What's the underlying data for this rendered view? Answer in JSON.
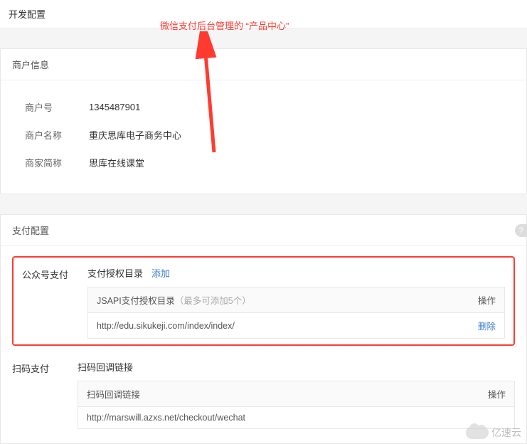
{
  "page": {
    "title": "开发配置"
  },
  "annotation": {
    "text": "微信支付后台管理的 “产品中心”"
  },
  "merchant_info": {
    "header": "商户信息",
    "rows": [
      {
        "label": "商户号",
        "value": "1345487901"
      },
      {
        "label": "商户名称",
        "value": "重庆思库电子商务中心"
      },
      {
        "label": "商家简称",
        "value": "思库在线课堂"
      }
    ]
  },
  "pay_config": {
    "header": "支付配置",
    "gzh": {
      "section_label": "公众号支付",
      "auth_title": "支付授权目录",
      "add_label": "添加",
      "table": {
        "head_main": "JSAPI支付授权目录",
        "head_note": "（最多可添加5个）",
        "head_action": "操作",
        "rows": [
          {
            "value": "http://edu.sikukeji.com/index/index/",
            "action": "删除"
          }
        ]
      }
    },
    "scan": {
      "section_label": "扫码支付",
      "callback_title": "扫码回调链接",
      "table": {
        "head_main": "扫码回调链接",
        "head_action": "操作",
        "rows": [
          {
            "value": "http://marswill.azxs.net/checkout/wechat"
          }
        ]
      }
    }
  },
  "watermark": {
    "text": "亿速云"
  }
}
